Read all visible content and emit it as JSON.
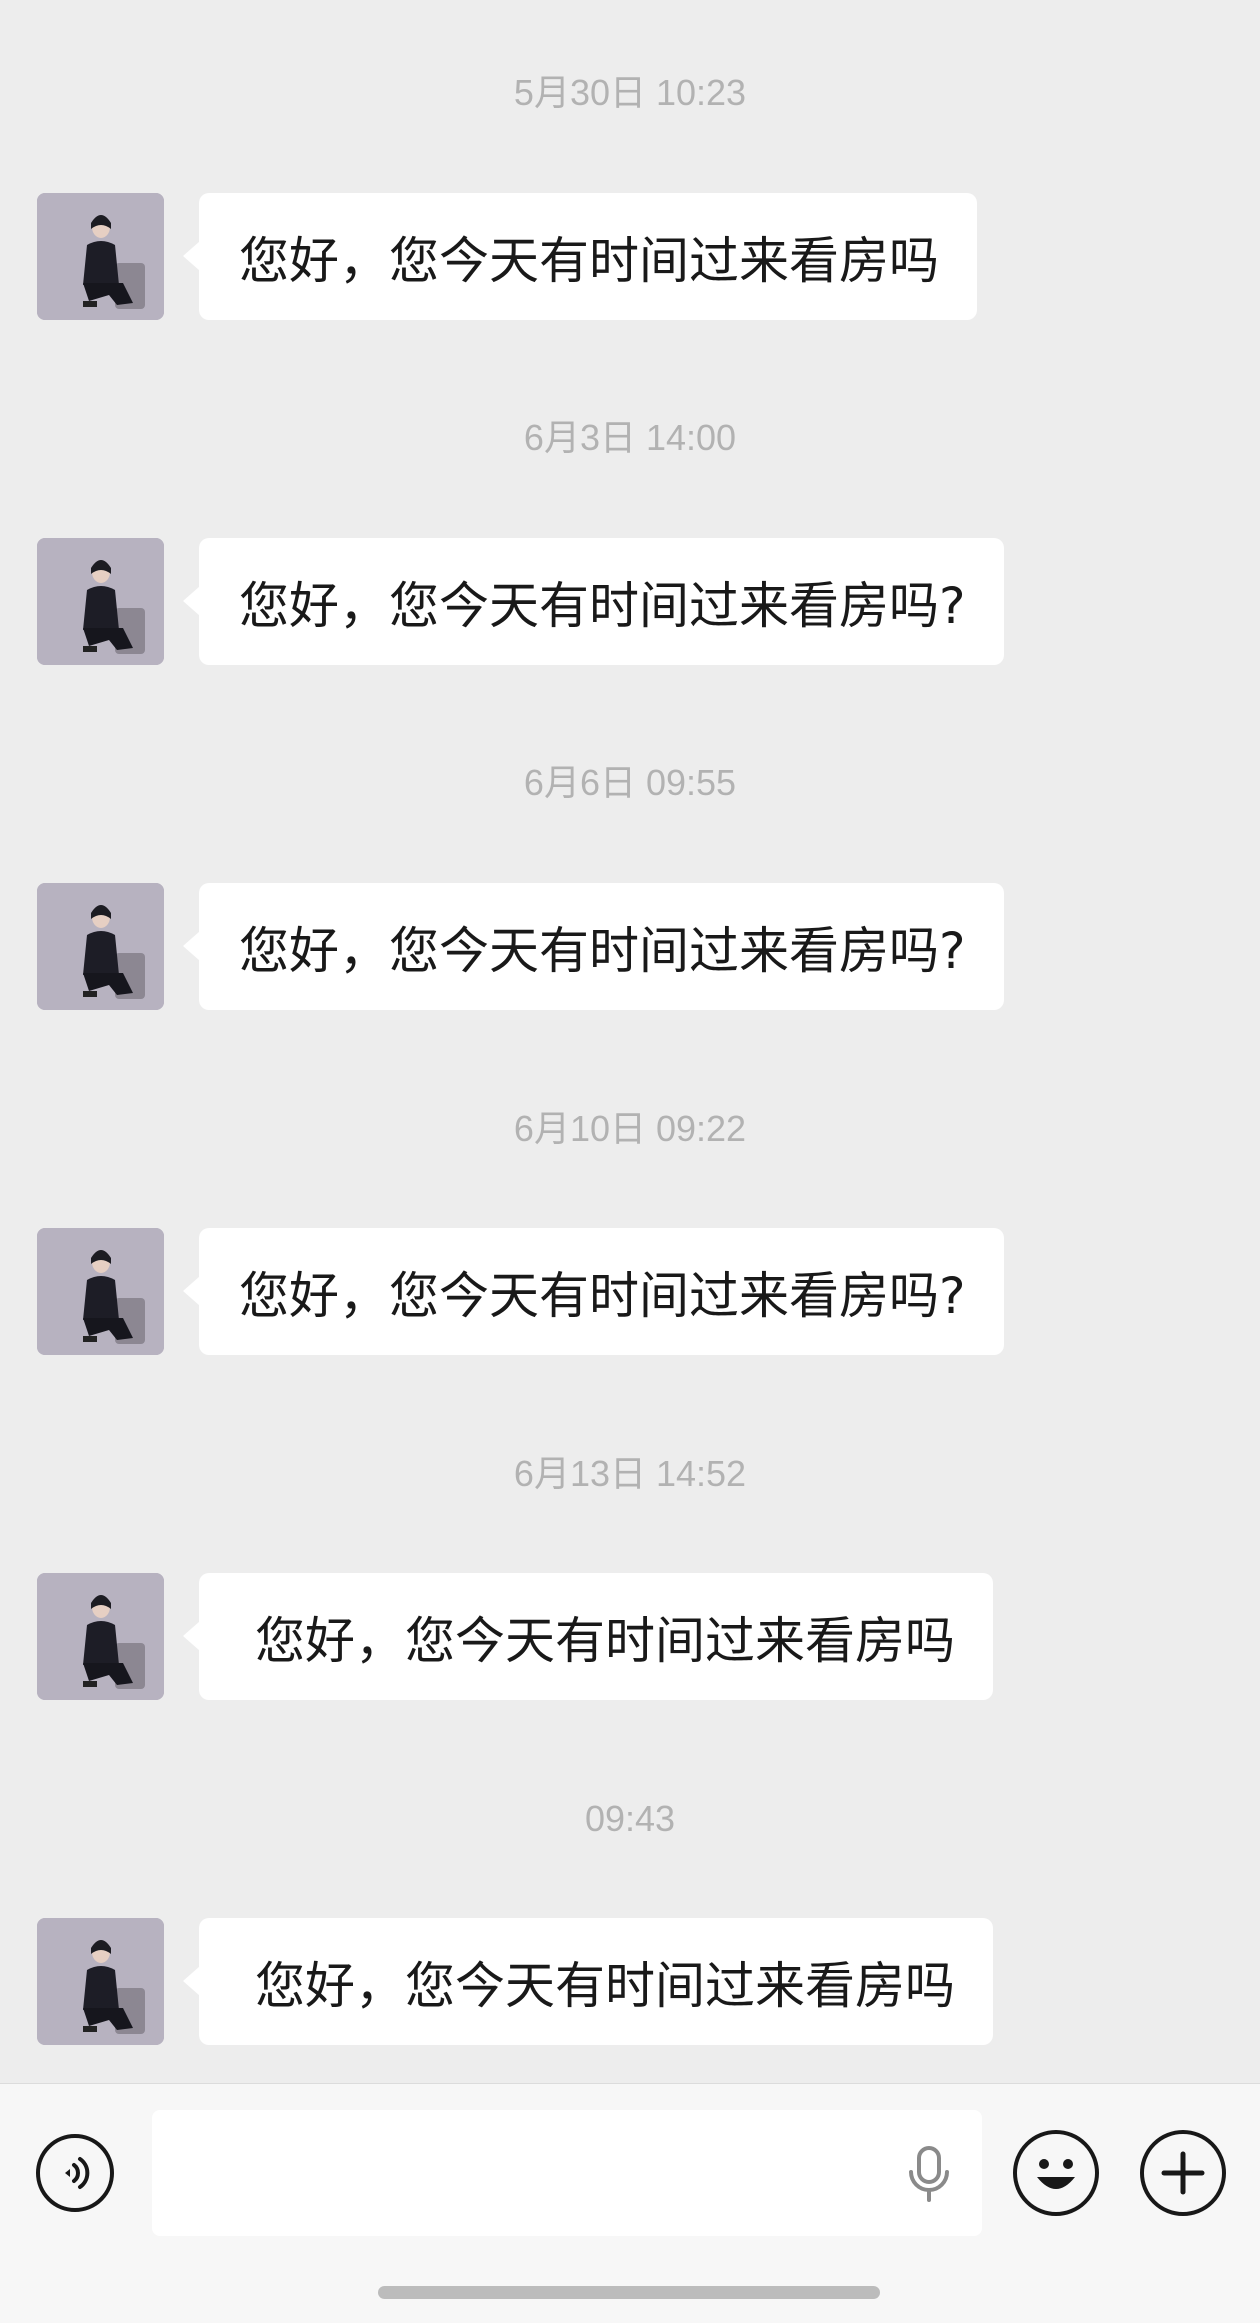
{
  "messages": [
    {
      "time": "5月30日 10:23",
      "text": "您好，您今天有时间过来看房吗"
    },
    {
      "time": "6月3日 14:00",
      "text": "您好，您今天有时间过来看房吗?"
    },
    {
      "time": "6月6日 09:55",
      "text": "您好，您今天有时间过来看房吗?"
    },
    {
      "time": "6月10日 09:22",
      "text": "您好，您今天有时间过来看房吗?"
    },
    {
      "time": "6月13日 14:52",
      "text": "您好，您今天有时间过来看房吗"
    },
    {
      "time": "09:43",
      "text": "您好，您今天有时间过来看房吗"
    }
  ],
  "input_bar": {
    "voice_icon": "voice-icon",
    "mic_icon": "microphone-icon",
    "emoji_icon": "smiley-icon",
    "plus_icon": "plus-icon"
  },
  "colors": {
    "background": "#ededed",
    "bubble": "#ffffff",
    "timestamp": "#b2b2b2",
    "input_bar": "#f7f7f7"
  }
}
